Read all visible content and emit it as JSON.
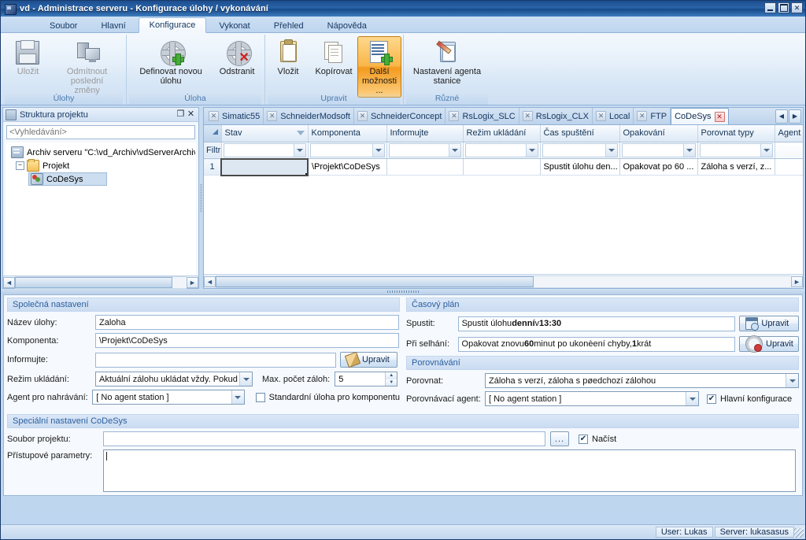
{
  "window": {
    "title": "vd - Administrace serveru - Konfigurace úlohy / vykonávání",
    "minimize_label": "_",
    "maximize_label": "□",
    "close_label": "✕"
  },
  "ribbon": {
    "tabs": [
      {
        "label": "Soubor",
        "active": false
      },
      {
        "label": "Hlavní",
        "active": false
      },
      {
        "label": "Konfigurace",
        "active": true
      },
      {
        "label": "Vykonat",
        "active": false
      },
      {
        "label": "Přehled",
        "active": false
      },
      {
        "label": "Nápověda",
        "active": false
      }
    ],
    "groups": [
      {
        "label": "Úlohy",
        "buttons": [
          {
            "label": "Uložit",
            "icon": "floppy-disk-icon",
            "state": "disabled"
          },
          {
            "label": "Odmítnout poslední změny",
            "icon": "revert-computer-icon",
            "state": "disabled"
          }
        ]
      },
      {
        "label": "Úloha",
        "buttons": [
          {
            "label": "Definovat novou úlohu",
            "icon": "gear-plus-icon",
            "state": "normal"
          },
          {
            "label": "Odstranit",
            "icon": "gear-delete-icon",
            "state": "normal"
          }
        ]
      },
      {
        "label": "Upravit",
        "buttons": [
          {
            "label": "Vložit",
            "icon": "clipboard-paste-icon",
            "state": "normal"
          },
          {
            "label": "Kopírovat",
            "icon": "copy-pages-icon",
            "state": "normal"
          },
          {
            "label": "Další možnosti ...",
            "icon": "list-plus-icon",
            "state": "selected"
          }
        ]
      },
      {
        "label": "Různé",
        "buttons": [
          {
            "label": "Nastavení agenta stanice",
            "icon": "agent-clipboard-icon",
            "state": "normal"
          }
        ]
      }
    ]
  },
  "project_panel": {
    "caption": "Struktura projektu",
    "caption_icon": "database-icon",
    "float_label": "❐",
    "close_label": "✕",
    "search_placeholder": "<Vyhledávání>",
    "search_value": "",
    "tree": [
      {
        "label": "Archiv serveru \"C:\\vd_Archiv\\vdServerArchive\"",
        "icon": "database-icon",
        "level": 0,
        "expander": "",
        "selected": false
      },
      {
        "label": "Projekt",
        "icon": "folder-icon",
        "level": 1,
        "expander": "−",
        "selected": false
      },
      {
        "label": "CoDeSys",
        "icon": "codesys-icon",
        "level": 2,
        "expander": "",
        "selected": true
      }
    ]
  },
  "doc_tabs": {
    "items": [
      {
        "label": "Simatic55",
        "active": false
      },
      {
        "label": "SchneiderModsoft",
        "active": false
      },
      {
        "label": "SchneiderConcept",
        "active": false
      },
      {
        "label": "RsLogix_SLC",
        "active": false
      },
      {
        "label": "RsLogix_CLX",
        "active": false
      },
      {
        "label": "Local",
        "active": false
      },
      {
        "label": "FTP",
        "active": false
      },
      {
        "label": "CoDeSys",
        "active": true
      }
    ],
    "prev_label": "◀",
    "next_label": "▶",
    "close_label": "✕"
  },
  "grid": {
    "filter_row_label": "Filtr",
    "row_number": "1",
    "columns": [
      {
        "label": "Stav",
        "width": 110,
        "sortable": true
      },
      {
        "label": "Komponenta",
        "width": 100,
        "sortable": false
      },
      {
        "label": "Informujte",
        "width": 97,
        "sortable": false
      },
      {
        "label": "Režim ukládání",
        "width": 98,
        "sortable": false
      },
      {
        "label": "Čas spuštění",
        "width": 101,
        "sortable": false
      },
      {
        "label": "Opakování",
        "width": 99,
        "sortable": false
      },
      {
        "label": "Porovnat typy",
        "width": 98,
        "sortable": false
      },
      {
        "label": "Agent pro r",
        "width": 105,
        "sortable": false
      }
    ],
    "rows": [
      {
        "cells": [
          "",
          "\\Projekt\\CoDeSys",
          "",
          "",
          "Spustit úlohu den...",
          "Opakovat po 60 ...",
          "Záloha s verzí, z...",
          ""
        ]
      }
    ]
  },
  "form": {
    "common": {
      "title": "Společná nastavení",
      "task_name_label": "Název úlohy:",
      "task_name_value": "Zaloha",
      "component_label": "Komponenta:",
      "component_value": "\\Projekt\\CoDeSys",
      "notify_label": "Informujte:",
      "notify_value": "",
      "notify_button": "Upravit",
      "save_mode_label": "Režim ukládání:",
      "save_mode_value": "Aktuální zálohu ukládat vždy. Pokud je :",
      "max_backups_label": "Max. počet záloh:",
      "max_backups_value": "5",
      "upload_agent_label": "Agent pro nahrávání:",
      "upload_agent_value": "[ No agent station ]",
      "standard_task_label": "Standardní úloha pro komponentu",
      "standard_task_checked": false
    },
    "schedule": {
      "title": "Časový plán",
      "start_label": "Spustit:",
      "start_value_prefix": "Spustit úlohu ",
      "start_value_bold1": "denní",
      "start_value_mid": " v ",
      "start_value_bold2": "13:30",
      "start_button": "Upravit",
      "failure_label": "Při selhání:",
      "failure_prefix": "Opakovat znovu ",
      "failure_bold1": "60",
      "failure_mid": " minut po ukonèení chyby, ",
      "failure_bold2": "1",
      "failure_suffix": " krát",
      "failure_button": "Upravit"
    },
    "compare": {
      "title": "Porovnávání",
      "compare_label": "Porovnat:",
      "compare_value": "Záloha s verzí, záloha s pøedchozí zálohou",
      "compare_agent_label": "Porovnávací agent:",
      "compare_agent_value": "[ No agent station ]",
      "main_config_label": "Hlavní konfigurace",
      "main_config_checked": true
    },
    "codesys": {
      "title": "Speciální nastavení CoDeSys",
      "project_file_label": "Soubor projektu:",
      "project_file_value": "",
      "browse_label": "...",
      "load_label": "Načíst",
      "load_checked": true,
      "access_params_label": "Přístupové parametry:",
      "access_params_value": ""
    }
  },
  "statusbar": {
    "user": "User: Lukas",
    "server": "Server: lukasasus"
  }
}
